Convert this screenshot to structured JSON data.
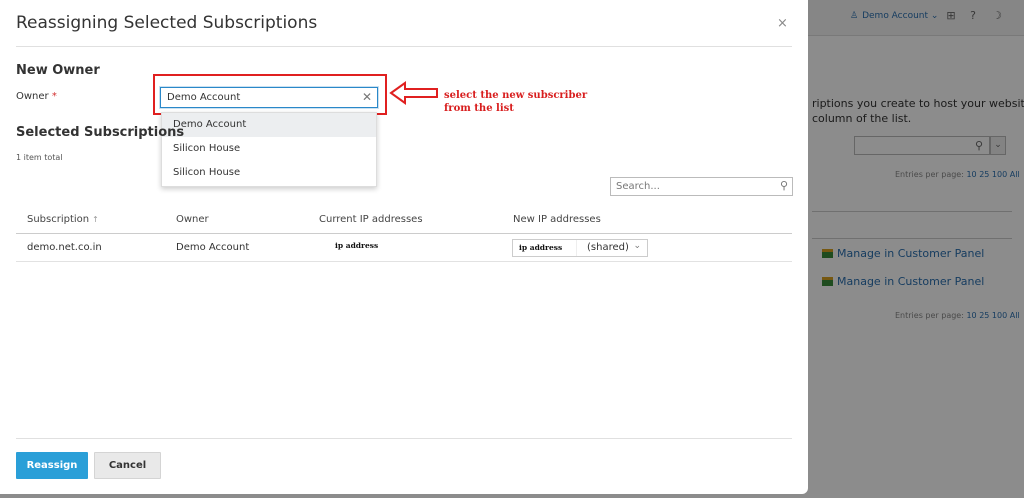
{
  "background": {
    "user_name": "Demo Account",
    "text_line1": "riptions you create to host your websites. To",
    "text_line2": "column of the list.",
    "entries_label": "Entries per page:",
    "entries_options": "10 25 100 All",
    "manage_link": "Manage in Customer Panel"
  },
  "dialog": {
    "title": "Reassigning Selected Subscriptions",
    "close_glyph": "×",
    "new_owner_heading": "New Owner",
    "owner_label": "Owner",
    "required_mark": "*",
    "owner_value": "Demo Account",
    "owner_options": [
      "Demo Account",
      "Silicon House",
      "Silicon House"
    ],
    "selected_heading": "Selected Subscriptions",
    "items_total": "1 item total",
    "search_placeholder": "Search...",
    "table": {
      "headers": [
        "Subscription",
        "Owner",
        "Current IP addresses",
        "New IP addresses"
      ],
      "sort_glyph": "↑",
      "rows": [
        {
          "subscription": "demo.net.co.in",
          "owner": "Demo Account",
          "current_ip": "ip address",
          "new_ip": "ip address",
          "new_ip_type": "(shared)"
        }
      ]
    },
    "reassign_label": "Reassign",
    "cancel_label": "Cancel"
  },
  "annotation": {
    "line1": "select the new subscriber",
    "line2": "from the list",
    "color": "#e02020"
  },
  "colors": {
    "primary": "#2a9fd8",
    "link": "#2a6fb0",
    "required": "#d32f2f"
  }
}
